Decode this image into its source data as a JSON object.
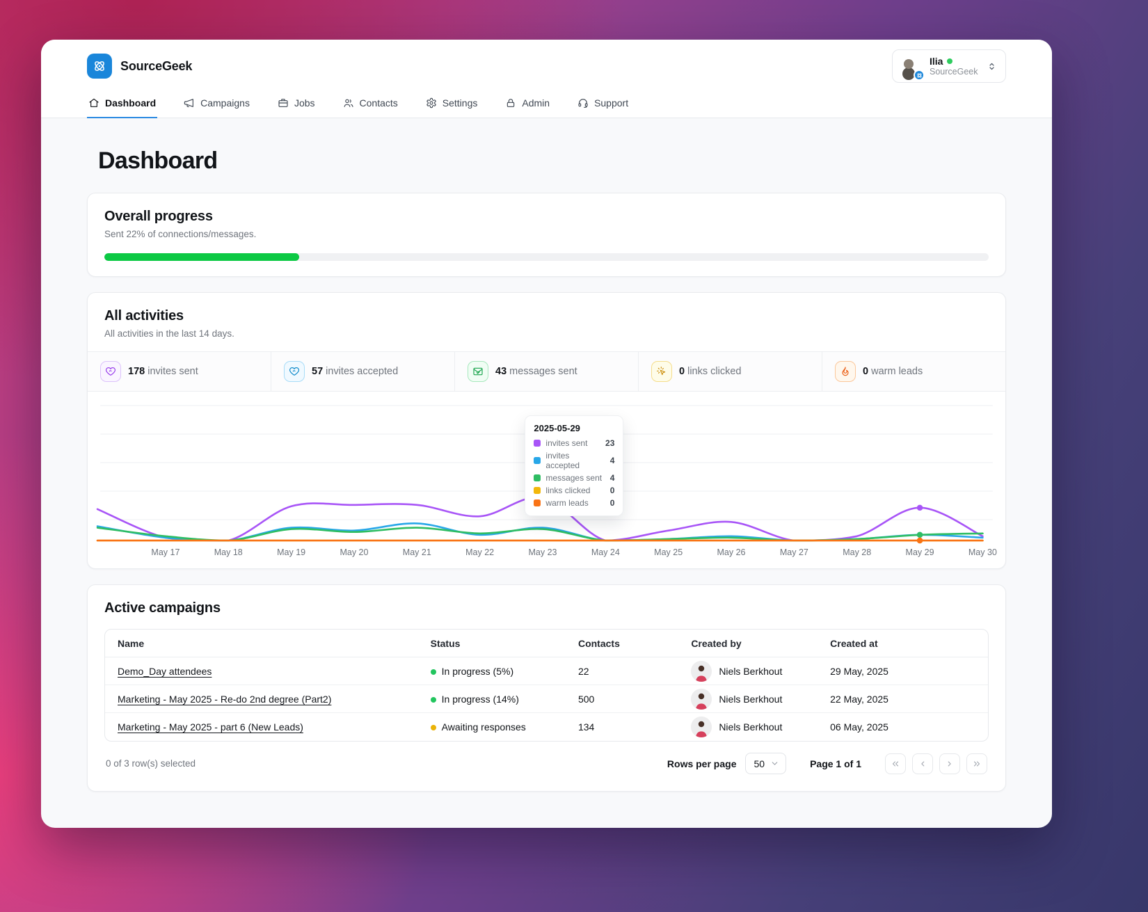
{
  "colors": {
    "accent_blue": "#1a86da",
    "progress_green": "#0cc944",
    "green_status": "#22c55e",
    "yellow_status": "#eab308"
  },
  "header": {
    "brand": "SourceGeek",
    "nav": [
      {
        "label": "Dashboard",
        "icon": "home-icon",
        "active": true
      },
      {
        "label": "Campaigns",
        "icon": "megaphone-icon",
        "active": false
      },
      {
        "label": "Jobs",
        "icon": "briefcase-icon",
        "active": false
      },
      {
        "label": "Contacts",
        "icon": "users-icon",
        "active": false
      },
      {
        "label": "Settings",
        "icon": "gear-icon",
        "active": false
      },
      {
        "label": "Admin",
        "icon": "lock-icon",
        "active": false
      },
      {
        "label": "Support",
        "icon": "headset-icon",
        "active": false
      }
    ],
    "user": {
      "name": "Ilia",
      "org": "SourceGeek",
      "status_color": "#2ecc5e"
    }
  },
  "page": {
    "title": "Dashboard"
  },
  "overall_progress": {
    "title": "Overall progress",
    "subtitle": "Sent 22% of connections/messages.",
    "percent": 22,
    "percent_css": "22%"
  },
  "activities": {
    "title": "All activities",
    "subtitle": "All activities in the last 14 days.",
    "stats": [
      {
        "value": "178",
        "label": "invites sent",
        "icon": "heart-send-icon",
        "fg": "#9333ea",
        "border": "#dcc2fb",
        "bg": "#faf5ff"
      },
      {
        "value": "57",
        "label": "invites accepted",
        "icon": "heart-accept-icon",
        "fg": "#0284c7",
        "border": "#a8dcf8",
        "bg": "#f0f9ff"
      },
      {
        "value": "43",
        "label": "messages sent",
        "icon": "mail-check-icon",
        "fg": "#16a34a",
        "border": "#a7e8bd",
        "bg": "#f0fdf4"
      },
      {
        "value": "0",
        "label": "links clicked",
        "icon": "cursor-click-icon",
        "fg": "#ca8a04",
        "border": "#f5dd8a",
        "bg": "#fefce8"
      },
      {
        "value": "0",
        "label": "warm leads",
        "icon": "flame-icon",
        "fg": "#ea580c",
        "border": "#fbc79a",
        "bg": "#fff7ed"
      }
    ],
    "tooltip": {
      "date": "2025-05-29",
      "rows": [
        {
          "label": "invites sent",
          "value": "23",
          "color": "#a855f7"
        },
        {
          "label": "invites accepted",
          "value": "4",
          "color": "#28a7e8"
        },
        {
          "label": "messages sent",
          "value": "4",
          "color": "#2fbd63"
        },
        {
          "label": "links clicked",
          "value": "0",
          "color": "#f2b70a"
        },
        {
          "label": "warm leads",
          "value": "0",
          "color": "#f97316"
        }
      ]
    }
  },
  "chart_data": {
    "type": "line",
    "title": "All activities in the last 14 days",
    "x": [
      "May 17",
      "May 18",
      "May 19",
      "May 20",
      "May 21",
      "May 22",
      "May 23",
      "May 24",
      "May 25",
      "May 26",
      "May 27",
      "May 28",
      "May 29",
      "May 30"
    ],
    "series": [
      {
        "name": "invites sent",
        "color": "#a855f7",
        "lead_in": 22,
        "values": [
          2,
          0,
          24,
          25,
          25,
          17,
          30,
          0,
          7,
          13,
          0,
          3,
          23,
          3
        ]
      },
      {
        "name": "invites accepted",
        "color": "#28a7e8",
        "lead_in": 10,
        "values": [
          2,
          0,
          9,
          7,
          12,
          4,
          9,
          0,
          1,
          3,
          0,
          1,
          4,
          2
        ]
      },
      {
        "name": "messages sent",
        "color": "#2fbd63",
        "lead_in": 9,
        "values": [
          3,
          0,
          8,
          6,
          9,
          5,
          8,
          0,
          1,
          2,
          0,
          1,
          4,
          5
        ]
      },
      {
        "name": "links clicked",
        "color": "#f2b70a",
        "lead_in": 0,
        "values": [
          0,
          0,
          0,
          0,
          0,
          0,
          0,
          0,
          0,
          0,
          0,
          0,
          0,
          0
        ]
      },
      {
        "name": "warm leads",
        "color": "#f97316",
        "lead_in": 0,
        "values": [
          0,
          0,
          0,
          0,
          0,
          0,
          0,
          0,
          0,
          0,
          0,
          0,
          0,
          0
        ]
      }
    ],
    "highlight_index": 12,
    "grid": true,
    "legend_position": "tooltip",
    "ylim": [
      0,
      100
    ]
  },
  "campaigns": {
    "title": "Active campaigns",
    "columns": [
      "Name",
      "Status",
      "Contacts",
      "Created by",
      "Created at"
    ],
    "rows": [
      {
        "name": "Demo_Day attendees",
        "status": "In progress (5%)",
        "status_color": "#22c55e",
        "contacts": "22",
        "created_by": "Niels Berkhout",
        "created_at": "29 May, 2025"
      },
      {
        "name": "Marketing - May 2025 - Re-do 2nd degree (Part2)",
        "status": "In progress (14%)",
        "status_color": "#22c55e",
        "contacts": "500",
        "created_by": "Niels Berkhout",
        "created_at": "22 May, 2025"
      },
      {
        "name": "Marketing - May 2025 - part 6 (New Leads)",
        "status": "Awaiting responses",
        "status_color": "#eab308",
        "contacts": "134",
        "created_by": "Niels Berkhout",
        "created_at": "06 May, 2025"
      }
    ],
    "footer": {
      "selected_note": "0 of 3 row(s) selected",
      "rows_per_page_label": "Rows per page",
      "rows_per_page_value": "50",
      "page_info": "Page 1 of 1"
    }
  }
}
